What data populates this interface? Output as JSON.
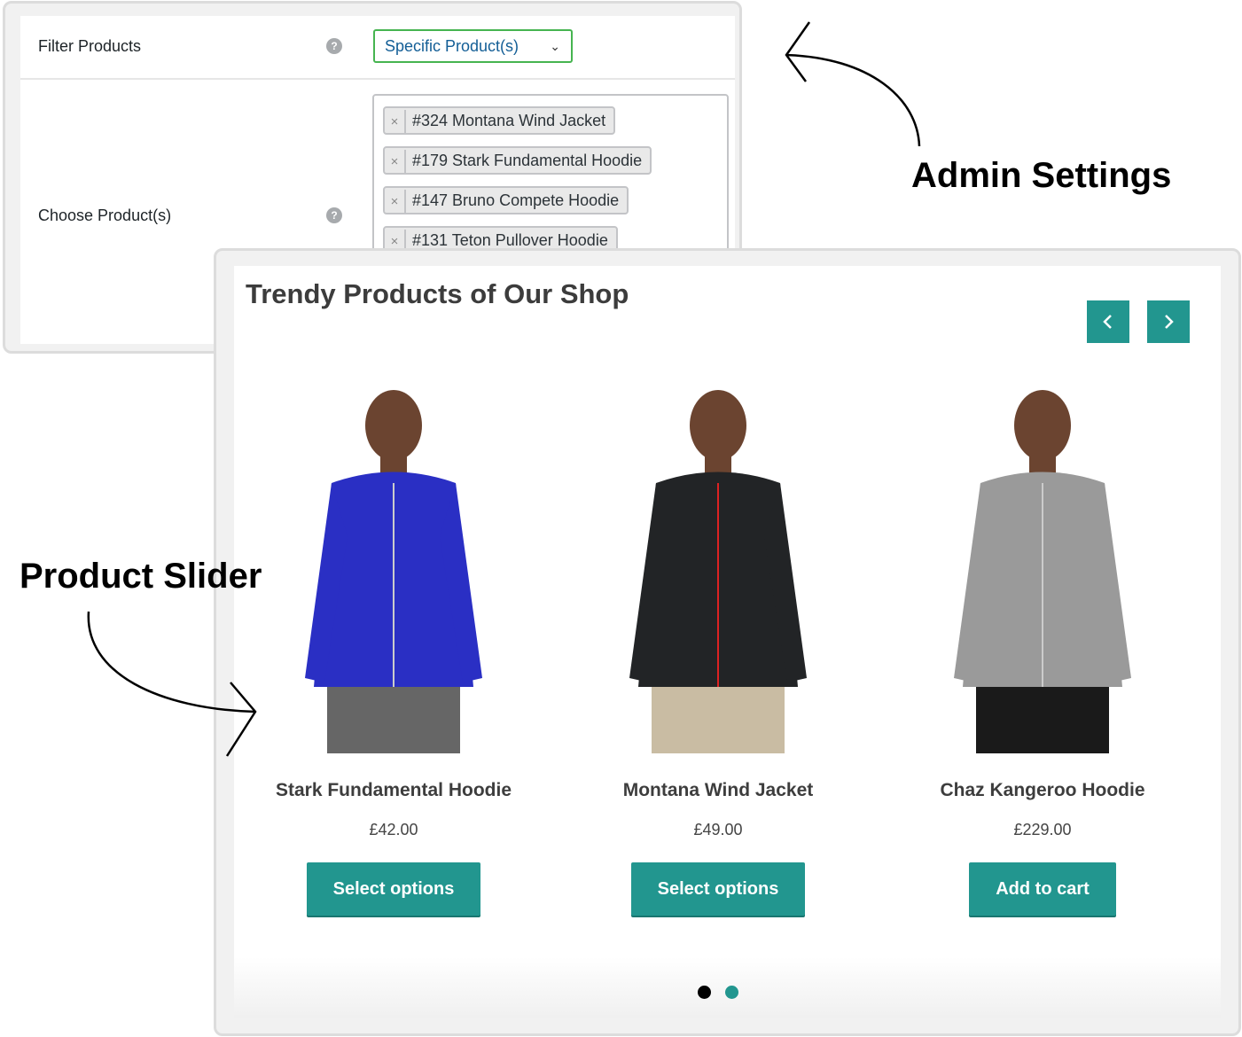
{
  "admin": {
    "filter_label": "Filter Products",
    "filter_value": "Specific Product(s)",
    "choose_label": "Choose Product(s)",
    "help_glyph": "?",
    "remove_glyph": "×",
    "selected_products": [
      "#324 Montana Wind Jacket",
      "#179 Stark Fundamental Hoodie",
      "#147 Bruno Compete Hoodie",
      "#131 Teton Pullover Hoodie"
    ]
  },
  "slider": {
    "title": "Trendy Products of Our Shop",
    "accent_color": "#22968f",
    "products": [
      {
        "name": "Stark Fundamental Hoodie",
        "price": "£42.00",
        "button": "Select options",
        "color": "#2a2fc4"
      },
      {
        "name": "Montana Wind Jacket",
        "price": "£49.00",
        "button": "Select options",
        "color": "#222426"
      },
      {
        "name": "Chaz Kangeroo Hoodie",
        "price": "£229.00",
        "button": "Add to cart",
        "color": "#9a9a9a"
      }
    ],
    "pagination": {
      "pages": 2,
      "active": 1
    }
  },
  "annotations": {
    "admin": "Admin Settings",
    "slider": "Product Slider"
  }
}
